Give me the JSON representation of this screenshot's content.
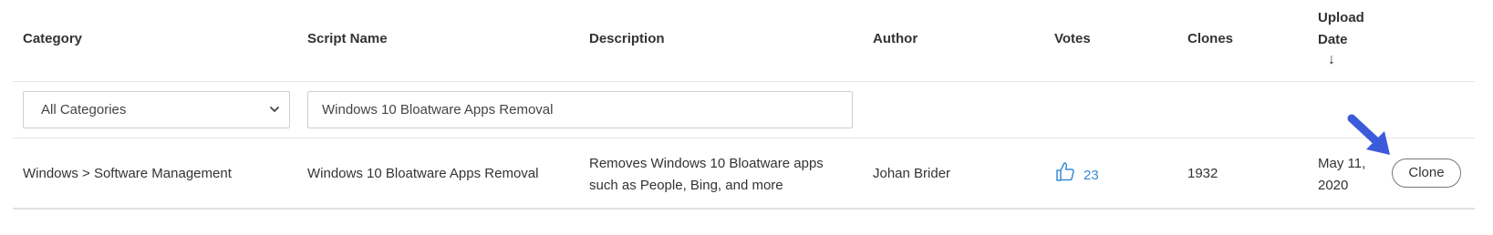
{
  "table": {
    "headers": {
      "category": "Category",
      "script_name": "Script Name",
      "description": "Description",
      "author": "Author",
      "votes": "Votes",
      "clones": "Clones",
      "upload_date": "Upload Date",
      "sort_indicator": "↓"
    },
    "filters": {
      "category_selected": "All Categories",
      "search_value": "Windows 10 Bloatware Apps Removal"
    },
    "rows": [
      {
        "category": "Windows > Software Management",
        "script_name": "Windows 10 Bloatware Apps Removal",
        "description": "Removes Windows 10 Bloatware apps such as People, Bing, and more",
        "author": "Johan Brider",
        "votes": "23",
        "clones": "1932",
        "upload_date": "May 11, 2020",
        "action_label": "Clone"
      }
    ]
  },
  "colors": {
    "link_blue": "#3a8ad6",
    "annotation_arrow": "#3b5bdb"
  },
  "icons": {
    "votes": "thumbs-up-icon",
    "select": "chevron-down-icon",
    "annotation": "pointer-arrow-icon"
  }
}
